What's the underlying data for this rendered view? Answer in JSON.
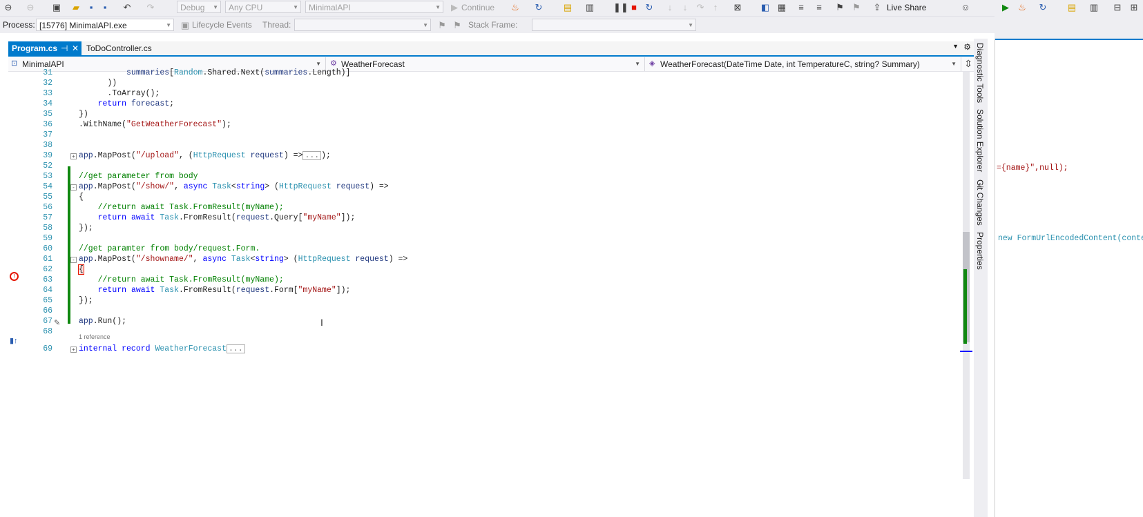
{
  "toolbar": {
    "config": "Debug",
    "platform": "Any CPU",
    "startup": "MinimalAPI",
    "continue_label": "Continue",
    "live_share": "Live Share"
  },
  "process_bar": {
    "process_label": "Process:",
    "process_value": "[15776] MinimalAPI.exe",
    "lifecycle_label": "Lifecycle Events",
    "thread_label": "Thread:",
    "stack_label": "Stack Frame:"
  },
  "tabs": [
    {
      "label": "Program.cs",
      "active": true
    },
    {
      "label": "ToDoController.cs",
      "active": false
    }
  ],
  "navbar": {
    "project": "MinimalAPI",
    "type": "WeatherForecast",
    "member": "WeatherForecast(DateTime Date, int TemperatureC, string? Summary)"
  },
  "editor": {
    "codelens": "1 reference"
  },
  "side_tabs": [
    "Diagnostic Tools",
    "Solution Explorer",
    "Git Changes",
    "Properties"
  ],
  "right_pane": {
    "line1": "={name}\",null);",
    "line2": "new FormUrlEncodedContent(conte"
  },
  "colors": {
    "accent": "#007acc",
    "change_bar": "#108810",
    "breakpoint": "#e51400"
  }
}
